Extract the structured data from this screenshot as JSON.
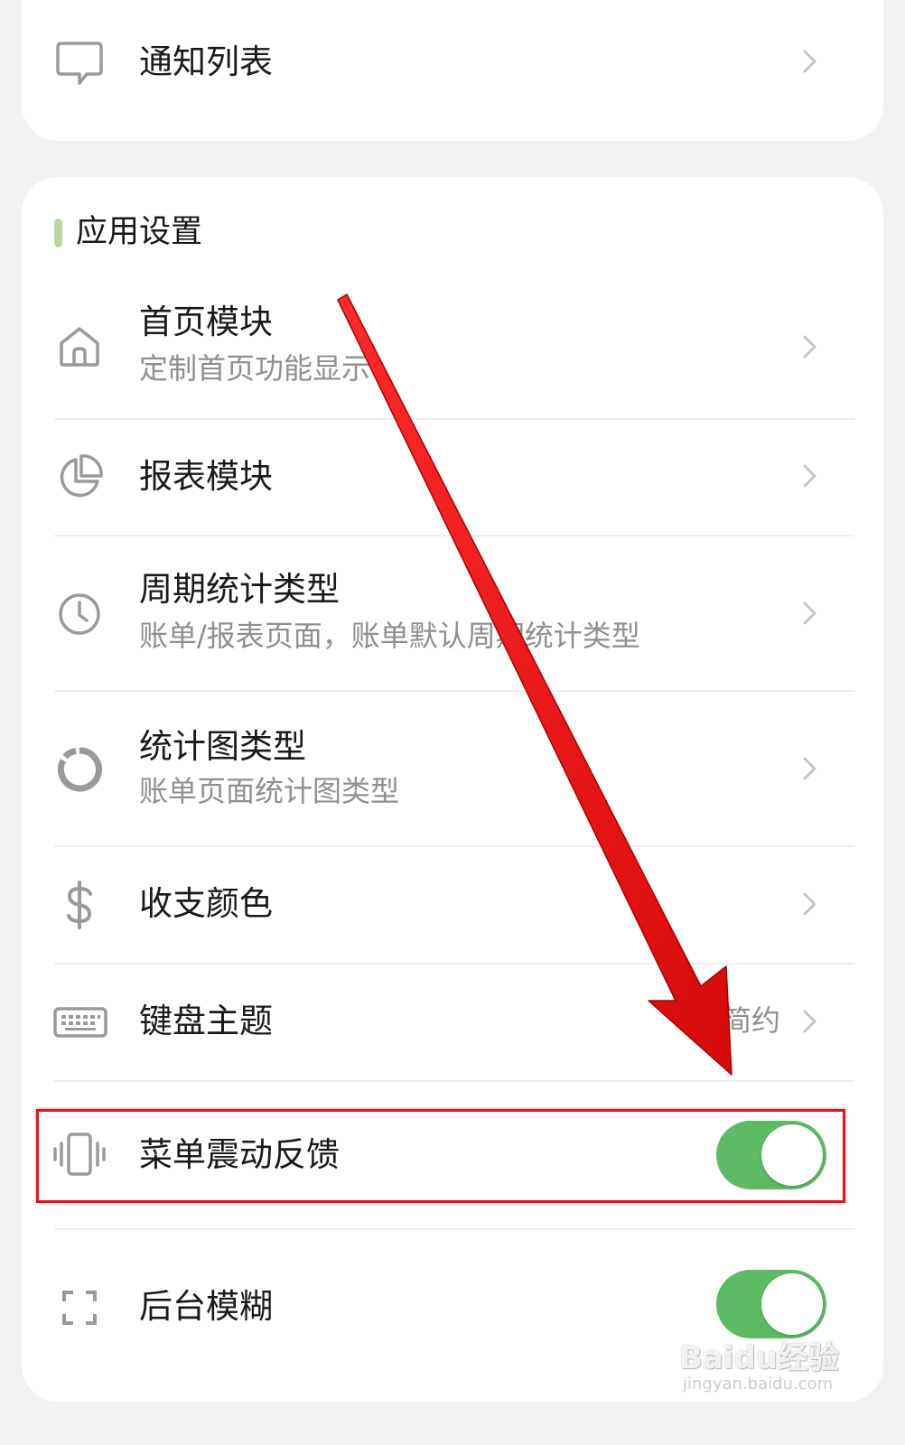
{
  "notification_card": {
    "item": {
      "label": "通知列表",
      "icon": "chat-bubble-icon"
    }
  },
  "app_settings": {
    "section_title": "应用设置",
    "accent_color": "#b9d7a6",
    "items": [
      {
        "label": "首页模块",
        "subtitle": "定制首页功能显示",
        "icon": "home-icon"
      },
      {
        "label": "报表模块",
        "icon": "pie-chart-icon"
      },
      {
        "label": "周期统计类型",
        "subtitle": "账单/报表页面，账单默认周期统计类型",
        "icon": "clock-icon"
      },
      {
        "label": "统计图类型",
        "subtitle": "账单页面统计图类型",
        "icon": "donut-chart-icon"
      },
      {
        "label": "收支颜色",
        "icon": "dollar-icon"
      },
      {
        "label": "键盘主题",
        "value": "简约",
        "icon": "keyboard-icon"
      },
      {
        "label": "菜单震动反馈",
        "icon": "vibrate-icon",
        "toggle_on": true
      },
      {
        "label": "后台模糊",
        "icon": "blur-frame-icon",
        "toggle_on": true
      }
    ]
  },
  "colors": {
    "toggle_on": "#5dbb63",
    "highlight_box": "#e0141e",
    "annotation_arrow": "#e01010"
  },
  "watermark": {
    "brand": "Baidu经验",
    "url": "jingyan.baidu.com"
  }
}
